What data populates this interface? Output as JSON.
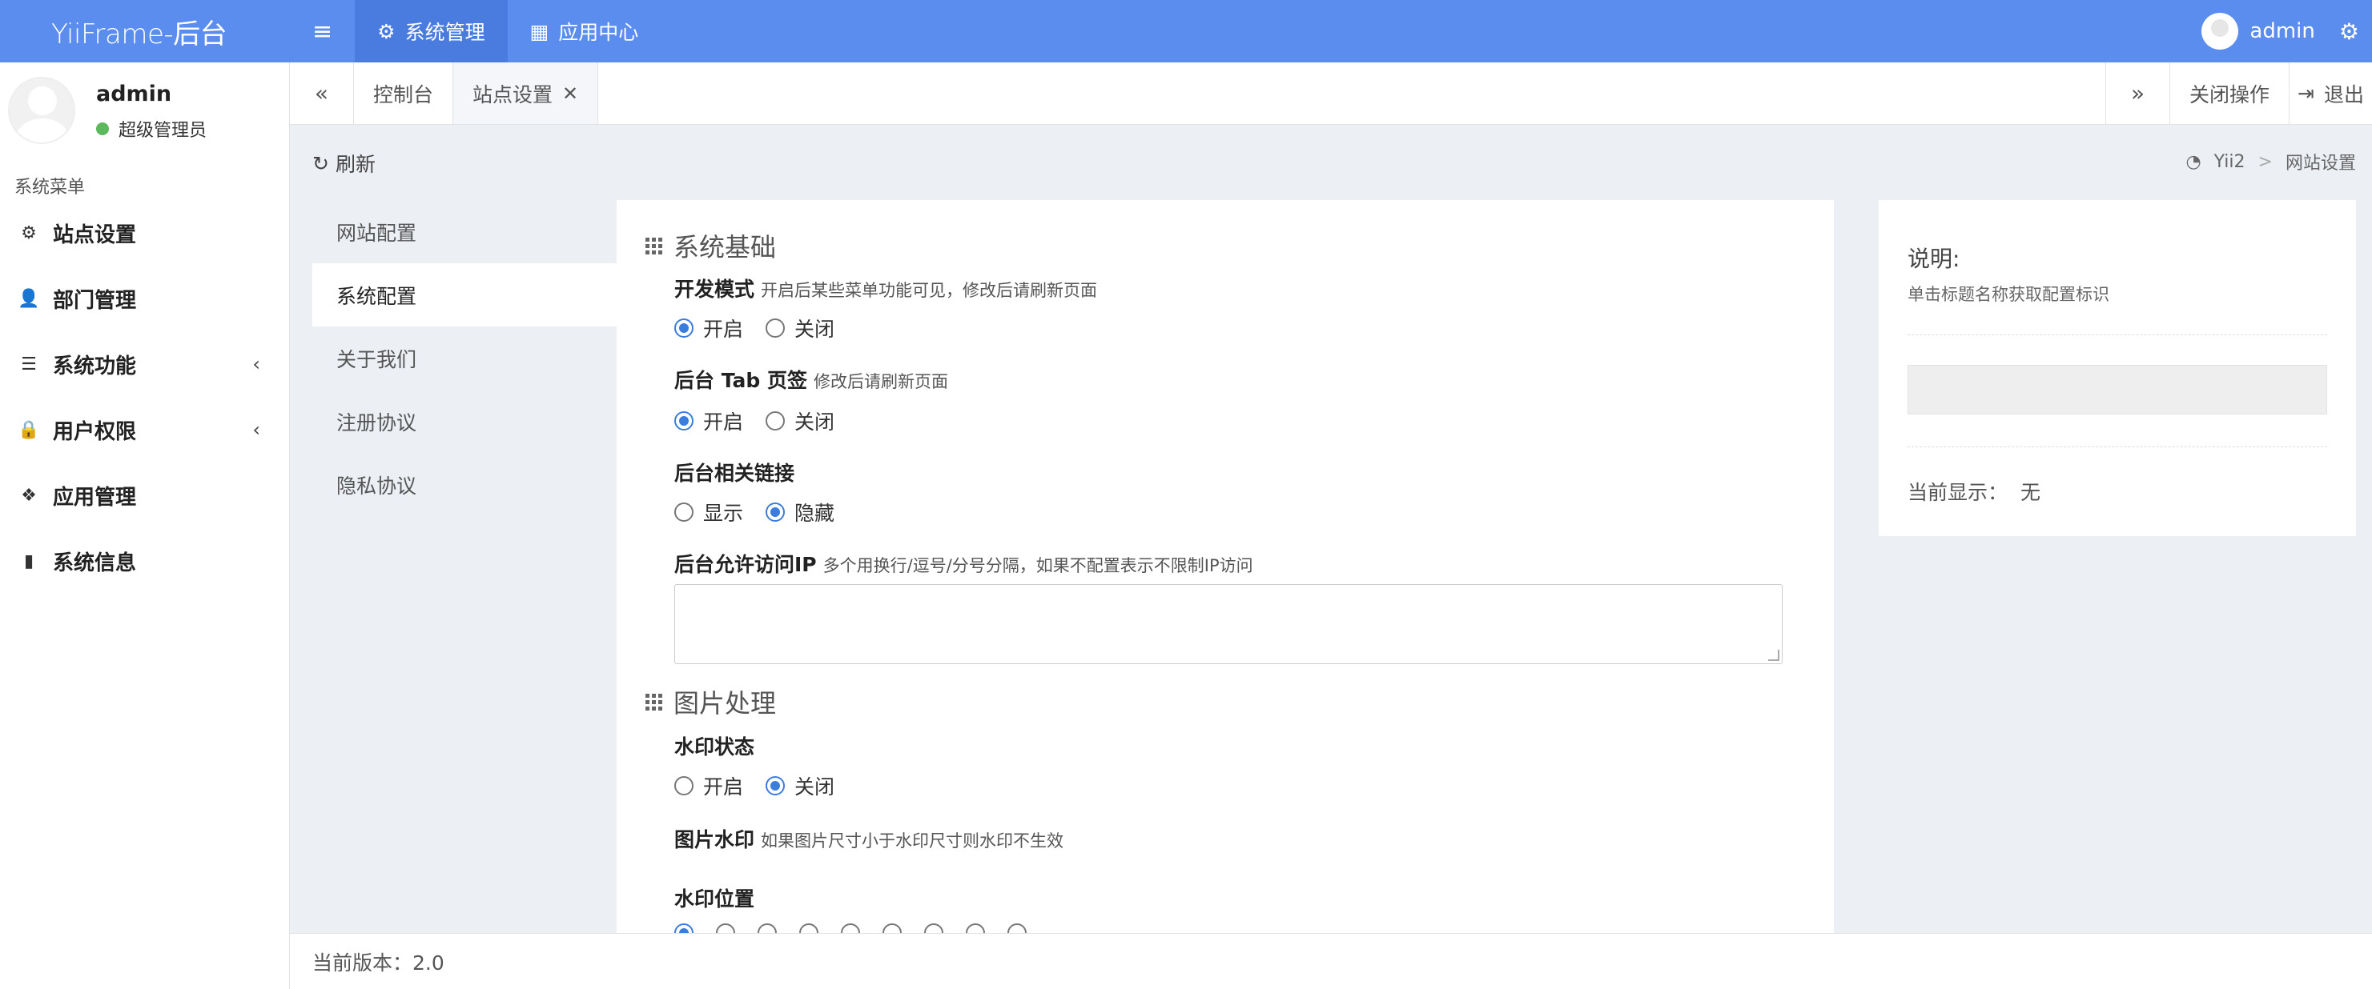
{
  "header": {
    "logo": "YiiFrame-后台",
    "nav": [
      {
        "label": "系统管理",
        "icon": "gears-icon"
      },
      {
        "label": "应用中心",
        "icon": "grid-icon"
      }
    ],
    "user": "admin"
  },
  "sidebar": {
    "user_name": "admin",
    "user_role": "超级管理员",
    "menu_header": "系统菜单",
    "items": [
      {
        "label": "站点设置",
        "icon": "gear-icon"
      },
      {
        "label": "部门管理",
        "icon": "user-plus-icon"
      },
      {
        "label": "系统功能",
        "icon": "list-icon"
      },
      {
        "label": "用户权限",
        "icon": "lock-icon"
      },
      {
        "label": "应用管理",
        "icon": "cubes-icon"
      },
      {
        "label": "系统信息",
        "icon": "server-icon"
      }
    ]
  },
  "tabs": {
    "items": [
      {
        "label": "控制台"
      },
      {
        "label": "站点设置"
      }
    ],
    "close_ops": "关闭操作",
    "logout": "退出"
  },
  "content": {
    "refresh": "刷新",
    "breadcrumb": [
      "Yii2",
      "网站设置"
    ]
  },
  "subnav": [
    "网站配置",
    "系统配置",
    "关于我们",
    "注册协议",
    "隐私协议"
  ],
  "form": {
    "section1": "系统基础",
    "dev_mode": {
      "label": "开发模式",
      "hint": "开启后某些菜单功能可见，修改后请刷新页面",
      "opt1": "开启",
      "opt2": "关闭"
    },
    "tab_page": {
      "label": "后台 Tab 页签",
      "hint": "修改后请刷新页面",
      "opt1": "开启",
      "opt2": "关闭"
    },
    "links": {
      "label": "后台相关链接",
      "opt1": "显示",
      "opt2": "隐藏"
    },
    "ip": {
      "label": "后台允许访问IP",
      "hint": "多个用换行/逗号/分号分隔，如果不配置表示不限制IP访问"
    },
    "section2": "图片处理",
    "watermark_status": {
      "label": "水印状态",
      "opt1": "开启",
      "opt2": "关闭"
    },
    "watermark_image": {
      "label": "图片水印",
      "hint": "如果图片尺寸小于水印尺寸则水印不生效"
    },
    "watermark_position": {
      "label": "水印位置"
    }
  },
  "info": {
    "title": "说明:",
    "desc": "单击标题名称获取配置标识",
    "current_label": "当前显示：",
    "current_value": "无"
  },
  "footer": {
    "version": "当前版本：2.0"
  }
}
